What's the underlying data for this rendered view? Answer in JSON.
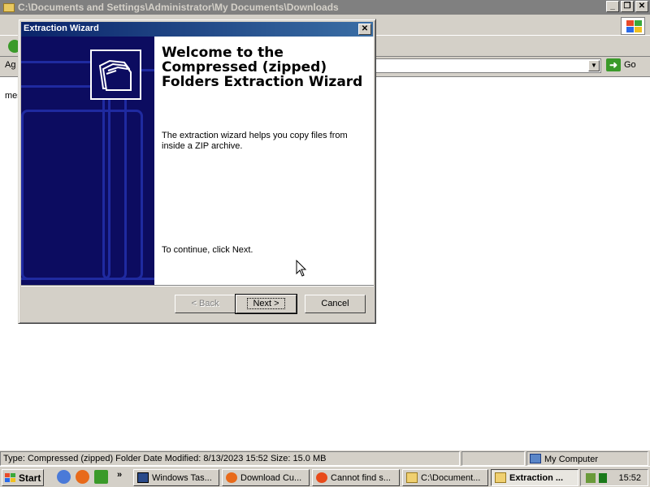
{
  "explorer": {
    "title": "C:\\Documents and Settings\\Administrator\\My Documents\\Downloads",
    "address_label": "Ag",
    "go_label": "Go",
    "fragment_text": "mes",
    "window_controls": [
      "_",
      "❐",
      "✕"
    ]
  },
  "statusbar": {
    "info": "Type: Compressed (zipped) Folder Date Modified: 8/13/2023 15:52 Size: 15.0 MB",
    "location": "My Computer"
  },
  "wizard": {
    "title": "Extraction Wizard",
    "close_glyph": "✕",
    "heading": "Welcome to the Compressed (zipped) Folders Extraction Wizard",
    "description": "The extraction wizard helps you copy files from inside a ZIP archive.",
    "continue_text": "To continue, click Next.",
    "buttons": {
      "back": "< Back",
      "next": "Next >",
      "cancel": "Cancel"
    },
    "icon": "zipped-folder-icon"
  },
  "taskbar": {
    "start_label": "Start",
    "chevron": "»",
    "tasks": [
      {
        "label": "Windows Tas...",
        "icon": "task-manager-icon",
        "active": false
      },
      {
        "label": "Download Cu...",
        "icon": "firefox-icon",
        "active": false
      },
      {
        "label": "Cannot find s...",
        "icon": "browser-icon",
        "active": false
      },
      {
        "label": "C:\\Document...",
        "icon": "folder-icon",
        "active": false
      },
      {
        "label": "Extraction ...",
        "icon": "folder-icon",
        "active": true
      }
    ],
    "clock": "15:52"
  },
  "colors": {
    "titlebar_active": "#0a246a",
    "banner": "#0c0c60",
    "face": "#d4d0c8"
  }
}
